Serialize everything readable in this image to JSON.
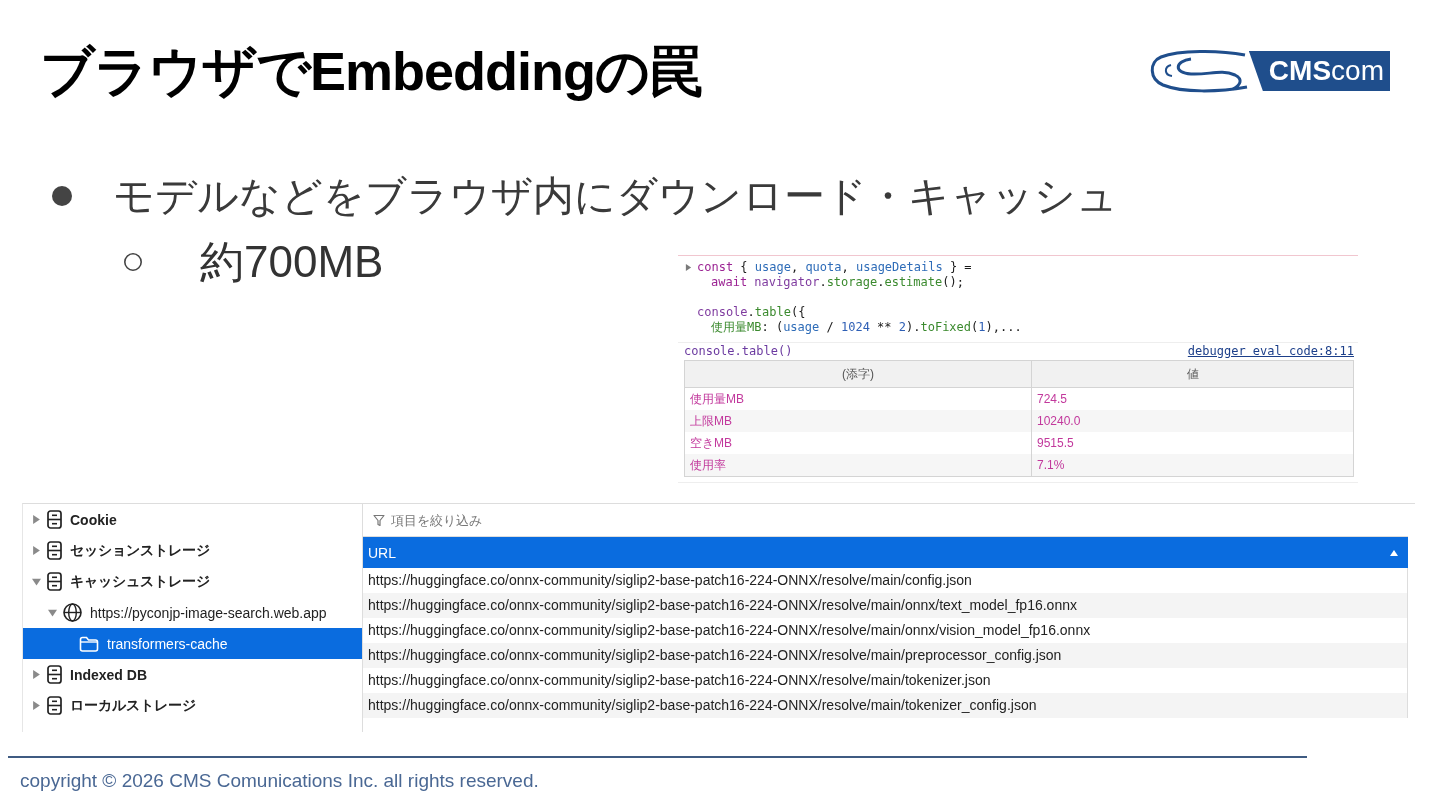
{
  "slide": {
    "title": "ブラウザでEmbeddingの罠",
    "logo": "**CMS**com"
  },
  "bullets": [
    {
      "text": "モデルなどをブラウザ内にダウンロード・キャッシュ",
      "children": [
        {
          "text": "約700MB"
        }
      ]
    }
  ],
  "console": {
    "input": {
      "expanded": false,
      "statements": [
        [
          [
            {
              "text": "const",
              "kind": "keyword"
            },
            {
              "text": " { ",
              "kind": "plain"
            },
            {
              "text": "usage",
              "kind": "variable"
            },
            {
              "text": ", ",
              "kind": "plain"
            },
            {
              "text": "quota",
              "kind": "variable"
            },
            {
              "text": ", ",
              "kind": "plain"
            },
            {
              "text": "usageDetails",
              "kind": "variable"
            },
            {
              "text": " } =",
              "kind": "plain"
            }
          ],
          [
            {
              "text": "await ",
              "kind": "keyword"
            },
            {
              "text": "navigator",
              "kind": "builtin"
            },
            {
              "text": ".",
              "kind": "plain"
            },
            {
              "text": "storage",
              "kind": "property"
            },
            {
              "text": ".",
              "kind": "plain"
            },
            {
              "text": "estimate",
              "kind": "property"
            },
            {
              "text": "();",
              "kind": "plain"
            }
          ]
        ],
        [
          [
            {
              "text": "console",
              "kind": "builtin"
            },
            {
              "text": ".",
              "kind": "plain"
            },
            {
              "text": "table",
              "kind": "property"
            },
            {
              "text": "({",
              "kind": "plain"
            }
          ],
          [
            {
              "text": "使用量MB",
              "kind": "property"
            },
            {
              "text": ": (",
              "kind": "plain"
            },
            {
              "text": "usage",
              "kind": "variable"
            },
            {
              "text": " / ",
              "kind": "plain"
            },
            {
              "text": "1024",
              "kind": "number"
            },
            {
              "text": " ** ",
              "kind": "plain"
            },
            {
              "text": "2",
              "kind": "number"
            },
            {
              "text": ").",
              "kind": "plain"
            },
            {
              "text": "toFixed",
              "kind": "property"
            },
            {
              "text": "(",
              "kind": "plain"
            },
            {
              "text": "1",
              "kind": "number"
            },
            {
              "text": "),...",
              "kind": "plain"
            }
          ]
        ]
      ]
    },
    "output": {
      "label": "console.table()",
      "source_link": "debugger eval code:8:11"
    },
    "table": {
      "columns": [
        "(添字)",
        "値"
      ],
      "rows": [
        [
          "使用量MB",
          "724.5"
        ],
        [
          "上限MB",
          "10240.0"
        ],
        [
          "空きMB",
          "9515.5"
        ],
        [
          "使用率",
          "7.1%"
        ]
      ]
    }
  },
  "storage": {
    "tree": [
      {
        "label": "Cookie",
        "kind": "storage",
        "expanded": false,
        "selected": false
      },
      {
        "label": "セッションストレージ",
        "kind": "storage",
        "expanded": false,
        "selected": false
      },
      {
        "label": "キャッシュストレージ",
        "kind": "storage",
        "expanded": true,
        "selected": false,
        "children": [
          {
            "label": "https://pyconjp-image-search.web.app",
            "kind": "origin",
            "expanded": true,
            "selected": false,
            "children": [
              {
                "label": "transformers-cache",
                "kind": "cache",
                "selected": true
              }
            ]
          }
        ]
      },
      {
        "label": "Indexed DB",
        "kind": "storage",
        "expanded": false,
        "selected": false
      },
      {
        "label": "ローカルストレージ",
        "kind": "storage",
        "expanded": false,
        "selected": false
      }
    ],
    "filter": {
      "placeholder": "項目を絞り込み"
    },
    "table": {
      "columns": [
        {
          "label": "URL",
          "sort_ascending": true
        }
      ],
      "rows": [
        "https://huggingface.co/onnx-community/siglip2-base-patch16-224-ONNX/resolve/main/config.json",
        "https://huggingface.co/onnx-community/siglip2-base-patch16-224-ONNX/resolve/main/onnx/text_model_fp16.onnx",
        "https://huggingface.co/onnx-community/siglip2-base-patch16-224-ONNX/resolve/main/onnx/vision_model_fp16.onnx",
        "https://huggingface.co/onnx-community/siglip2-base-patch16-224-ONNX/resolve/main/preprocessor_config.json",
        "https://huggingface.co/onnx-community/siglip2-base-patch16-224-ONNX/resolve/main/tokenizer.json",
        "https://huggingface.co/onnx-community/siglip2-base-patch16-224-ONNX/resolve/main/tokenizer_config.json"
      ]
    }
  },
  "footer": {
    "copyright": "copyright © 2026 CMS Comunications Inc. all rights reserved."
  }
}
